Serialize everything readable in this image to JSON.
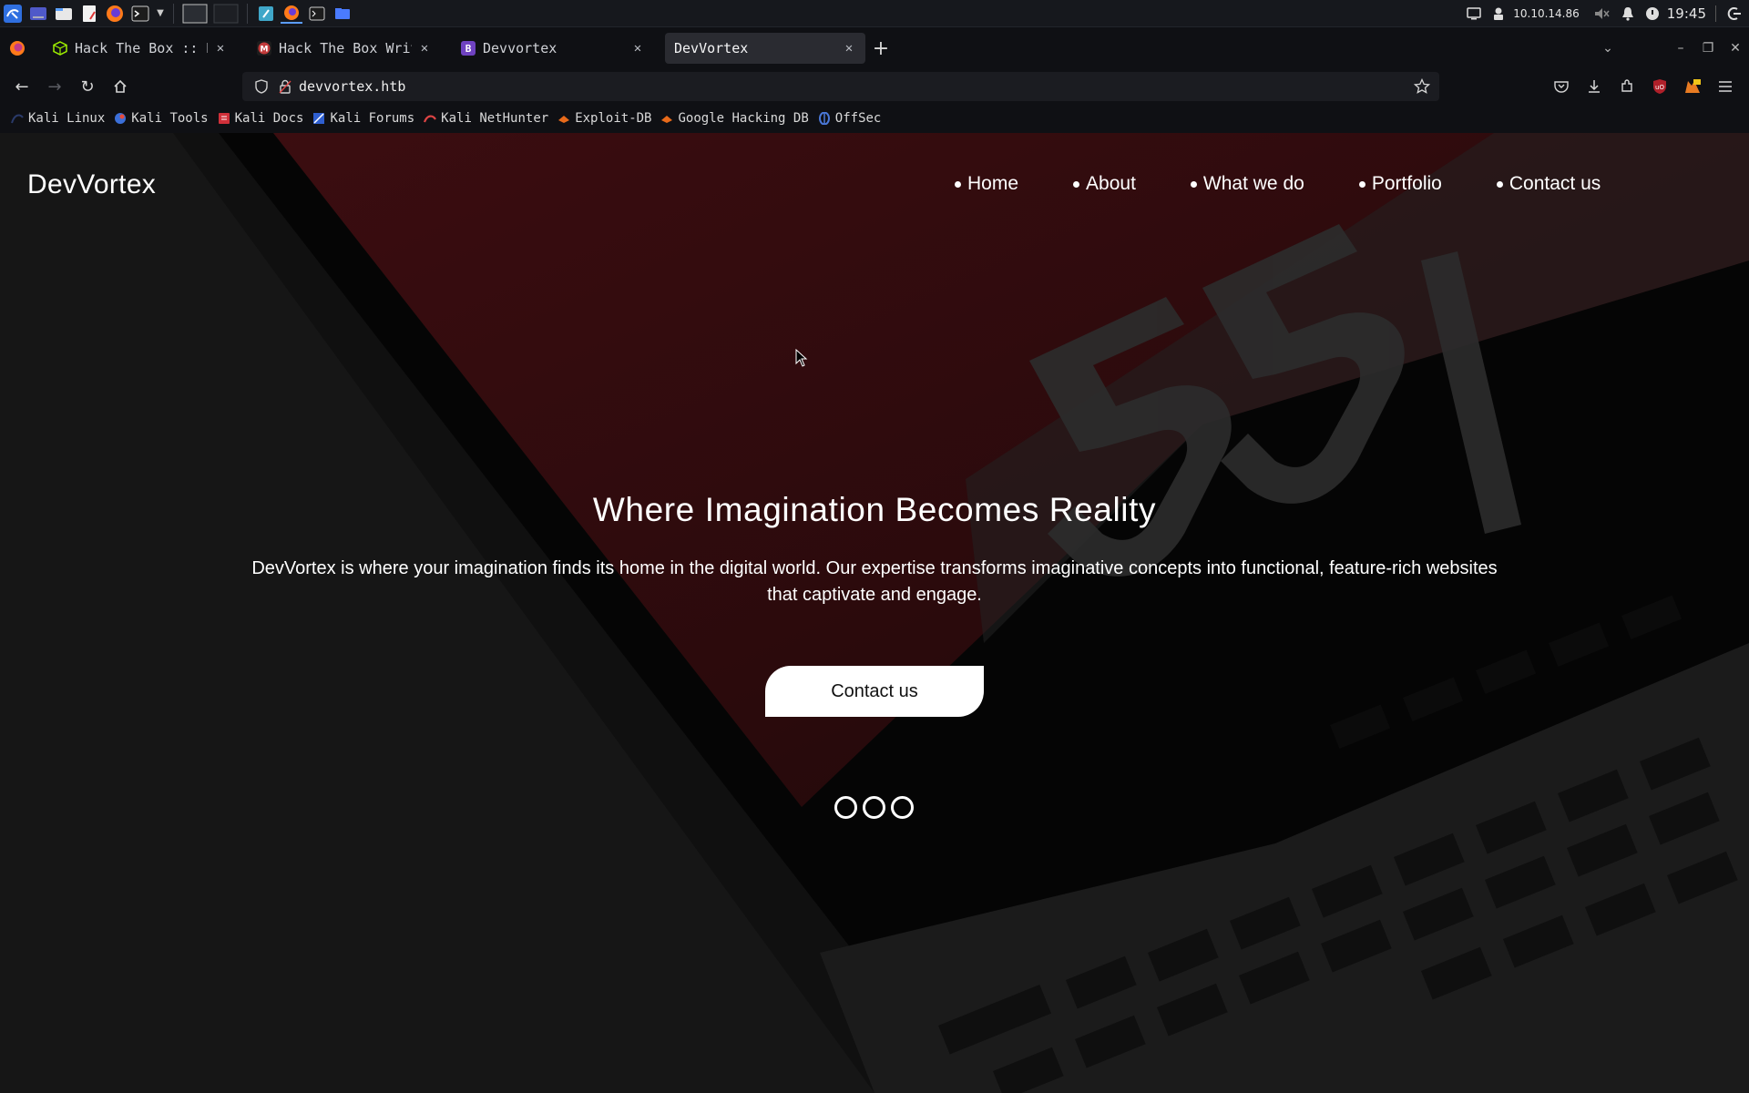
{
  "system": {
    "ip": "10.10.14.86",
    "time": "19:45"
  },
  "browser": {
    "tabs": [
      {
        "title": "Hack The Box :: Hack",
        "fav": "htb-cube-icon"
      },
      {
        "title": "Hack The Box Write-",
        "fav": "medium-icon"
      },
      {
        "title": "Devvortex",
        "fav": "bootstrap-icon"
      },
      {
        "title": "DevVortex",
        "fav": "none",
        "active": true
      }
    ],
    "url": "devvortex.htb",
    "bookmarks": [
      "Kali Linux",
      "Kali Tools",
      "Kali Docs",
      "Kali Forums",
      "Kali NetHunter",
      "Exploit-DB",
      "Google Hacking DB",
      "OffSec"
    ]
  },
  "site": {
    "logo": "DevVortex",
    "nav": [
      "Home",
      "About",
      "What we do",
      "Portfolio",
      "Contact us"
    ],
    "hero_title": "Where Imagination Becomes Reality",
    "hero_text": "DevVortex is where your imagination finds its home in the digital world. Our expertise transforms imaginative concepts into functional, feature-rich websites that captivate and engage.",
    "cta": "Contact us",
    "slide_count": 3
  },
  "colors": {
    "hero_red": "#3a0c0f",
    "panel_bg": "#16181d",
    "active_tab": "#2a2b31"
  }
}
